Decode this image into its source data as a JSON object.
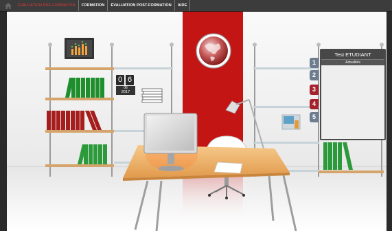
{
  "menu": {
    "items": [
      {
        "label": "ÉVALUATION PRÉ-FORMATION",
        "active": true
      },
      {
        "label": "FORMATION",
        "active": false
      },
      {
        "label": "ÉVALUATION POST-FORMATION",
        "active": false
      },
      {
        "label": "AIDE",
        "active": false
      }
    ]
  },
  "calendar": {
    "digit1": "0",
    "digit2": "6",
    "month": "06",
    "year": "2017"
  },
  "panel": {
    "title": "Test ETUDIANT",
    "subtitle": "Actualités"
  },
  "tabs": [
    {
      "label": "1",
      "color": "#6e7c90"
    },
    {
      "label": "2",
      "color": "#6e7c90"
    },
    {
      "label": "3",
      "color": "#a3222b"
    },
    {
      "label": "4",
      "color": "#a3222b"
    },
    {
      "label": "5",
      "color": "#6e7c90"
    }
  ],
  "colors": {
    "accent": "#c41515",
    "menubar": "#3c3c3c",
    "active_menu": "#e23838"
  },
  "icons": [
    "home-icon",
    "globe-icon",
    "chart-frame-icon",
    "desk-lamp-icon",
    "computer-monitor-icon"
  ]
}
